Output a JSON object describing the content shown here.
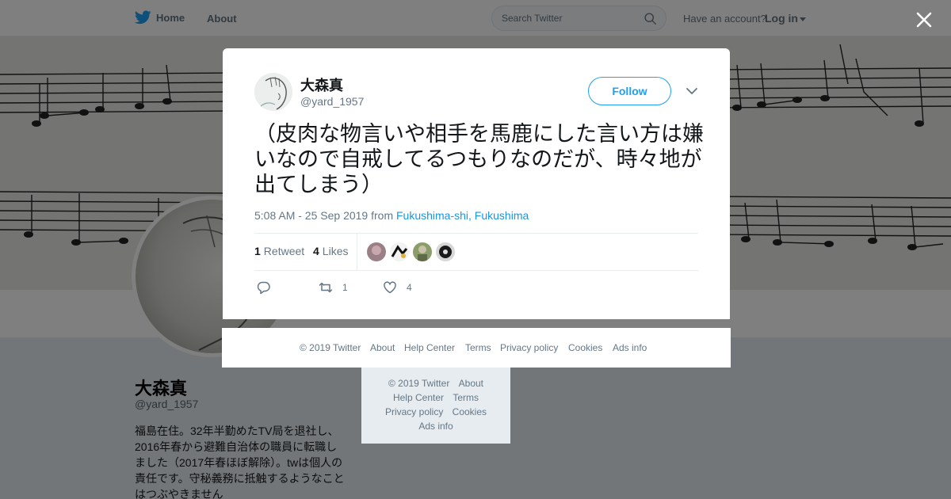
{
  "topbar": {
    "home_label": "Home",
    "about_label": "About",
    "search_placeholder": "Search Twitter",
    "have_account": "Have an account?",
    "login_label": "Log in"
  },
  "profile": {
    "name": "大森真",
    "handle": "@yard_1957",
    "bio": "福島在住。32年半勤めたTV局を退社し、2016年春から避難自治体の職員に転職しました（2017年春ほぼ解除）。twは個人の責任です。守秘義務に抵触するようなことはつぶやきません"
  },
  "side_footer": {
    "items": [
      "© 2019 Twitter",
      "About",
      "Help Center",
      "Terms",
      "Privacy policy",
      "Cookies",
      "Ads info"
    ]
  },
  "modal": {
    "author_name": "大森真",
    "author_handle": "@yard_1957",
    "follow_label": "Follow",
    "tweet_text": "（皮肉な物言いや相手を馬鹿にした言い方は嫌いなので自戒してるつもりなのだが、時々地が出てしまう）",
    "timestamp": "5:08 AM - 25 Sep 2019",
    "from_label": "from",
    "location": "Fukushima-shi, Fukushima",
    "retweet_count": "1",
    "retweet_label": "Retweet",
    "likes_count": "4",
    "likes_label": "Likes",
    "action_retweet_count": "1",
    "action_like_count": "4"
  },
  "footer": {
    "items": [
      "© 2019 Twitter",
      "About",
      "Help Center",
      "Terms",
      "Privacy policy",
      "Cookies",
      "Ads info"
    ]
  },
  "icons": {
    "brand": "twitter-bird-icon",
    "close": "close-icon",
    "search": "search-icon",
    "caret": "chevron-down-icon",
    "reply": "reply-icon",
    "retweet": "retweet-icon",
    "like": "heart-icon"
  },
  "colors": {
    "accent": "#1da1f2",
    "link": "#1b95e0",
    "muted": "#657786"
  }
}
